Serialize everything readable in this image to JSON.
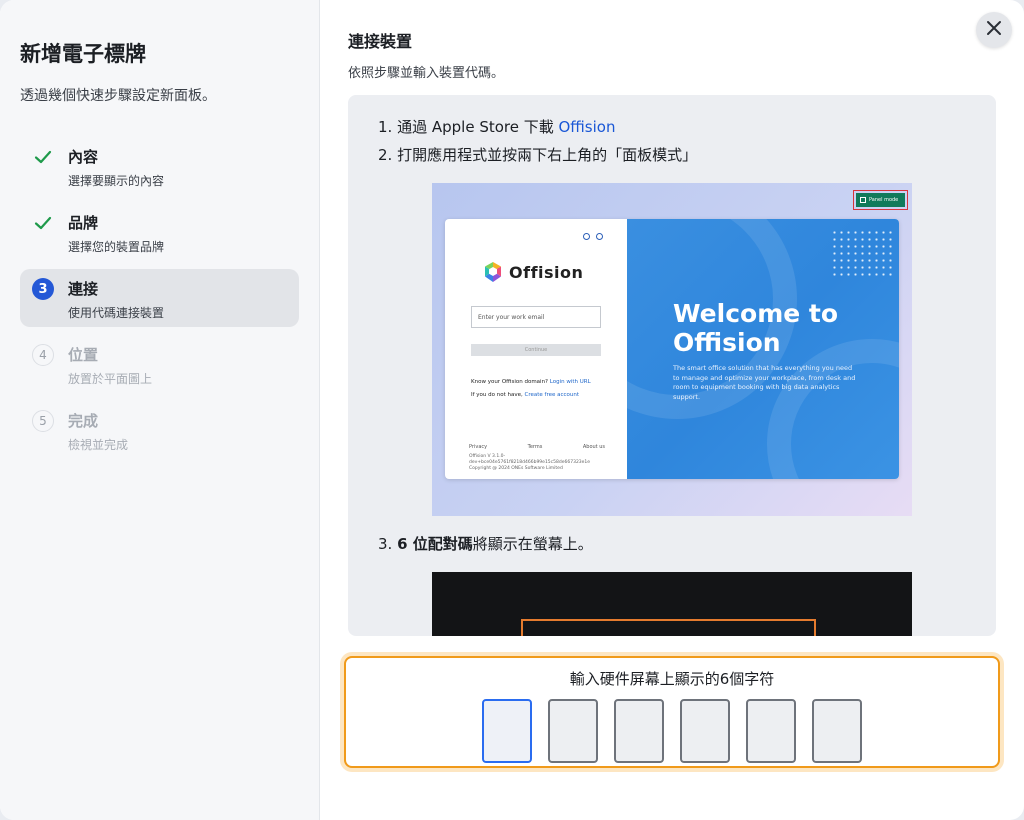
{
  "sidebar": {
    "title": "新增電子標牌",
    "subtitle": "透過幾個快速步驟設定新面板。",
    "steps": [
      {
        "marker": "",
        "label": "內容",
        "desc": "選擇要顯示的內容",
        "status": "done"
      },
      {
        "marker": "",
        "label": "品牌",
        "desc": "選擇您的裝置品牌",
        "status": "done"
      },
      {
        "marker": "3",
        "label": "連接",
        "desc": "使用代碼連接裝置",
        "status": "active"
      },
      {
        "marker": "4",
        "label": "位置",
        "desc": "放置於平面圖上",
        "status": "pending"
      },
      {
        "marker": "5",
        "label": "完成",
        "desc": "檢視並完成",
        "status": "pending"
      }
    ]
  },
  "main": {
    "title": "連接裝置",
    "subtitle": "依照步驟並輸入裝置代碼。",
    "instructions": {
      "step1_prefix": "1. 通過 Apple Store 下載 ",
      "step1_link": "Offision",
      "step2": "2. 打開應用程式並按兩下右上角的「面板模式」",
      "step3_prefix": "3. ",
      "step3_bold": "6 位配對碼",
      "step3_suffix": "將顯示在螢幕上。"
    },
    "screenshot": {
      "panel_mode": "Panel mode",
      "logo": "Offision",
      "email_placeholder": "Enter your work email",
      "continue": "Continue",
      "domain_q": "Know your Offision domain? ",
      "domain_link": "Login with URL",
      "no_account": "If you do not have, ",
      "no_account_link": "Create free account",
      "footer": [
        "Privacy",
        "Terms",
        "About us"
      ],
      "version": "Offision V 3.1.0-dev+bce04e5761f8218d466b99e15c58de667323e1e Copyright @ 2024 ONEs Software Limited",
      "welcome_line1": "Welcome to",
      "welcome_line2": "Offision",
      "welcome_desc": "The smart office solution that has everything you need to manage and optimize your workplace, from desk and room to equipment booking with big data analytics support."
    }
  },
  "code_entry": {
    "label": "輸入硬件屏幕上顯示的6個字符",
    "count": 6,
    "values": [
      "",
      "",
      "",
      "",
      "",
      ""
    ]
  },
  "colors": {
    "accent": "#2458d6",
    "check": "#1f9a4b",
    "code_border": "#f09a1a",
    "link": "#1a57d6"
  }
}
